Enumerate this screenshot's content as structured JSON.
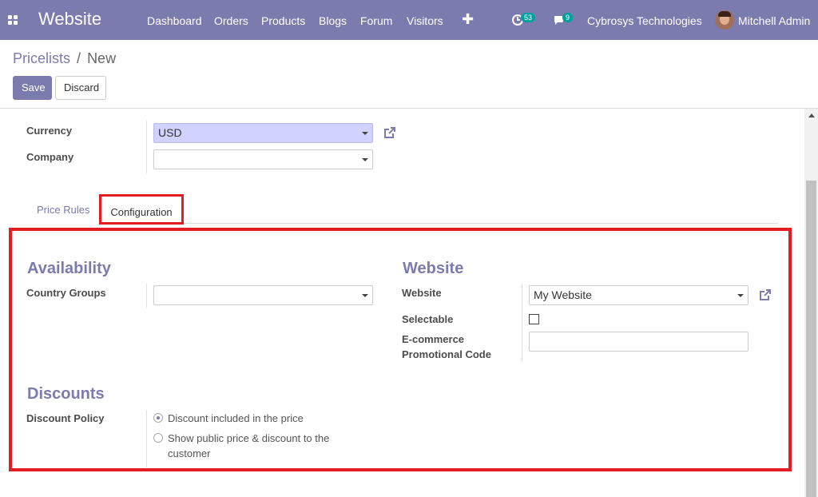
{
  "navbar": {
    "app_title": "Website",
    "menu": [
      "Dashboard",
      "Orders",
      "Products",
      "Blogs",
      "Forum",
      "Visitors"
    ],
    "activity_count": "53",
    "message_count": "9",
    "company": "Cybrosys Technologies",
    "user": "Mitchell Admin"
  },
  "breadcrumb": {
    "parent": "Pricelists",
    "separator": "/",
    "current": "New"
  },
  "buttons": {
    "save": "Save",
    "discard": "Discard"
  },
  "form": {
    "currency_label": "Currency",
    "currency_value": "USD",
    "company_label": "Company",
    "company_value": ""
  },
  "tabs": [
    "Price Rules",
    "Configuration"
  ],
  "active_tab": "Configuration",
  "configuration": {
    "availability_title": "Availability",
    "country_groups_label": "Country Groups",
    "country_groups_value": "",
    "website_title": "Website",
    "website_label": "Website",
    "website_value": "My Website",
    "selectable_label": "Selectable",
    "selectable_checked": false,
    "promo_label_1": "E-commerce",
    "promo_label_2": "Promotional Code",
    "promo_value": "",
    "discounts_title": "Discounts",
    "discount_policy_label": "Discount Policy",
    "discount_options": [
      {
        "line1": "Discount included in the price",
        "line2": "",
        "checked": true
      },
      {
        "line1": "Show public price & discount to the",
        "line2": "customer",
        "checked": false
      }
    ]
  },
  "colors": {
    "brand": "#7c7bad",
    "highlight": "#e31b23",
    "required_field": "#d2d2ff",
    "badge": "#00a09d"
  }
}
